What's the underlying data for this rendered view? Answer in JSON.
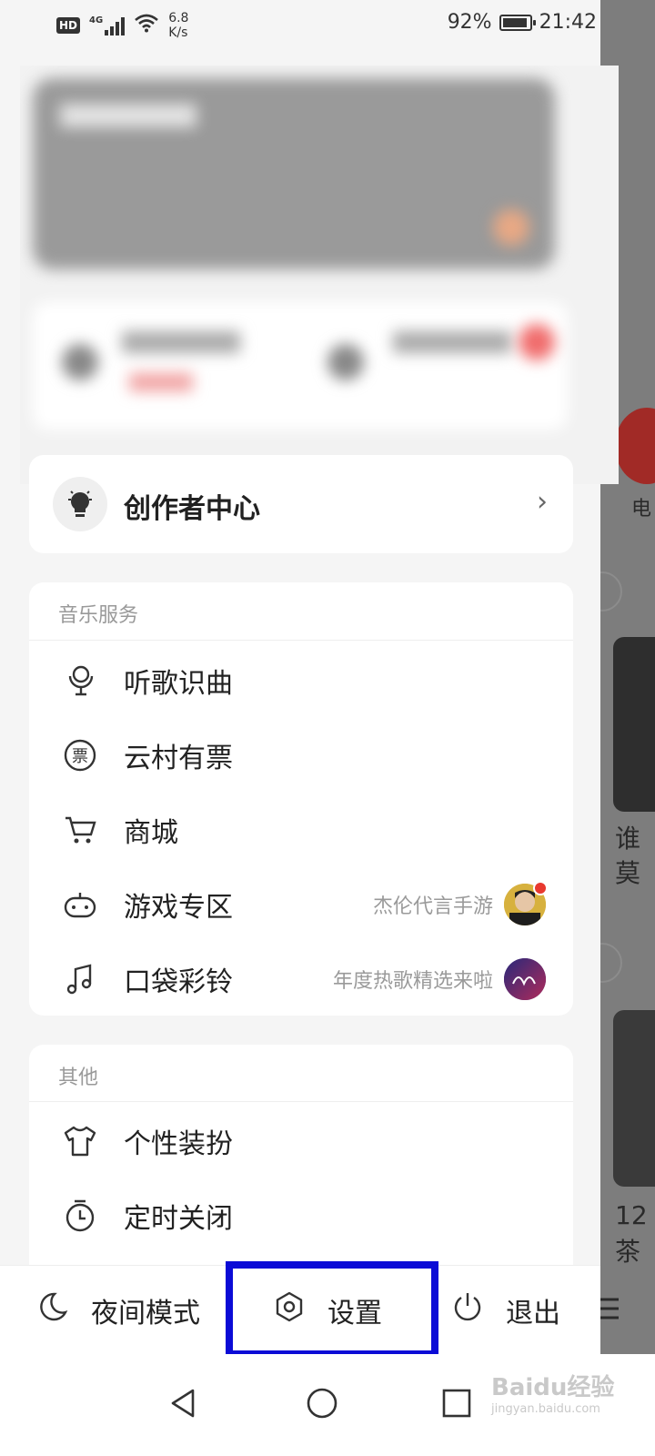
{
  "status_bar": {
    "hd": "HD",
    "network": "4G",
    "speed_value": "6.8",
    "speed_unit": "K/s",
    "battery": "92%",
    "battery_level": 0.92,
    "time": "21:42"
  },
  "creator_center": {
    "icon": "lightbulb-icon",
    "label": "创作者中心",
    "chevron": "›"
  },
  "music_services": {
    "title": "音乐服务",
    "items": [
      {
        "label": "听歌识曲",
        "icon": "microphone-icon",
        "extra": ""
      },
      {
        "label": "云村有票",
        "icon": "ticket-icon",
        "extra": ""
      },
      {
        "label": "商城",
        "icon": "cart-icon",
        "extra": ""
      },
      {
        "label": "游戏专区",
        "icon": "gamepad-icon",
        "extra": "杰伦代言手游"
      },
      {
        "label": "口袋彩铃",
        "icon": "music-note-icon",
        "extra": "年度热歌精选来啦"
      }
    ]
  },
  "others": {
    "title": "其他",
    "items": [
      {
        "label": "个性装扮",
        "icon": "tshirt-icon"
      },
      {
        "label": "定时关闭",
        "icon": "timer-icon"
      }
    ]
  },
  "bottom_bar": {
    "night_mode": "夜间模式",
    "settings": "设置",
    "logout": "退出"
  },
  "background_app": {
    "radio_label": "电",
    "text_1": "谁",
    "text_2": "莫",
    "text_3": "12",
    "text_4": "茶"
  },
  "watermark": {
    "main": "Baidu经验",
    "sub": "jingyan.baidu.com"
  },
  "colors": {
    "highlight": "#0b0bd6",
    "accent_red": "#e8392f"
  }
}
